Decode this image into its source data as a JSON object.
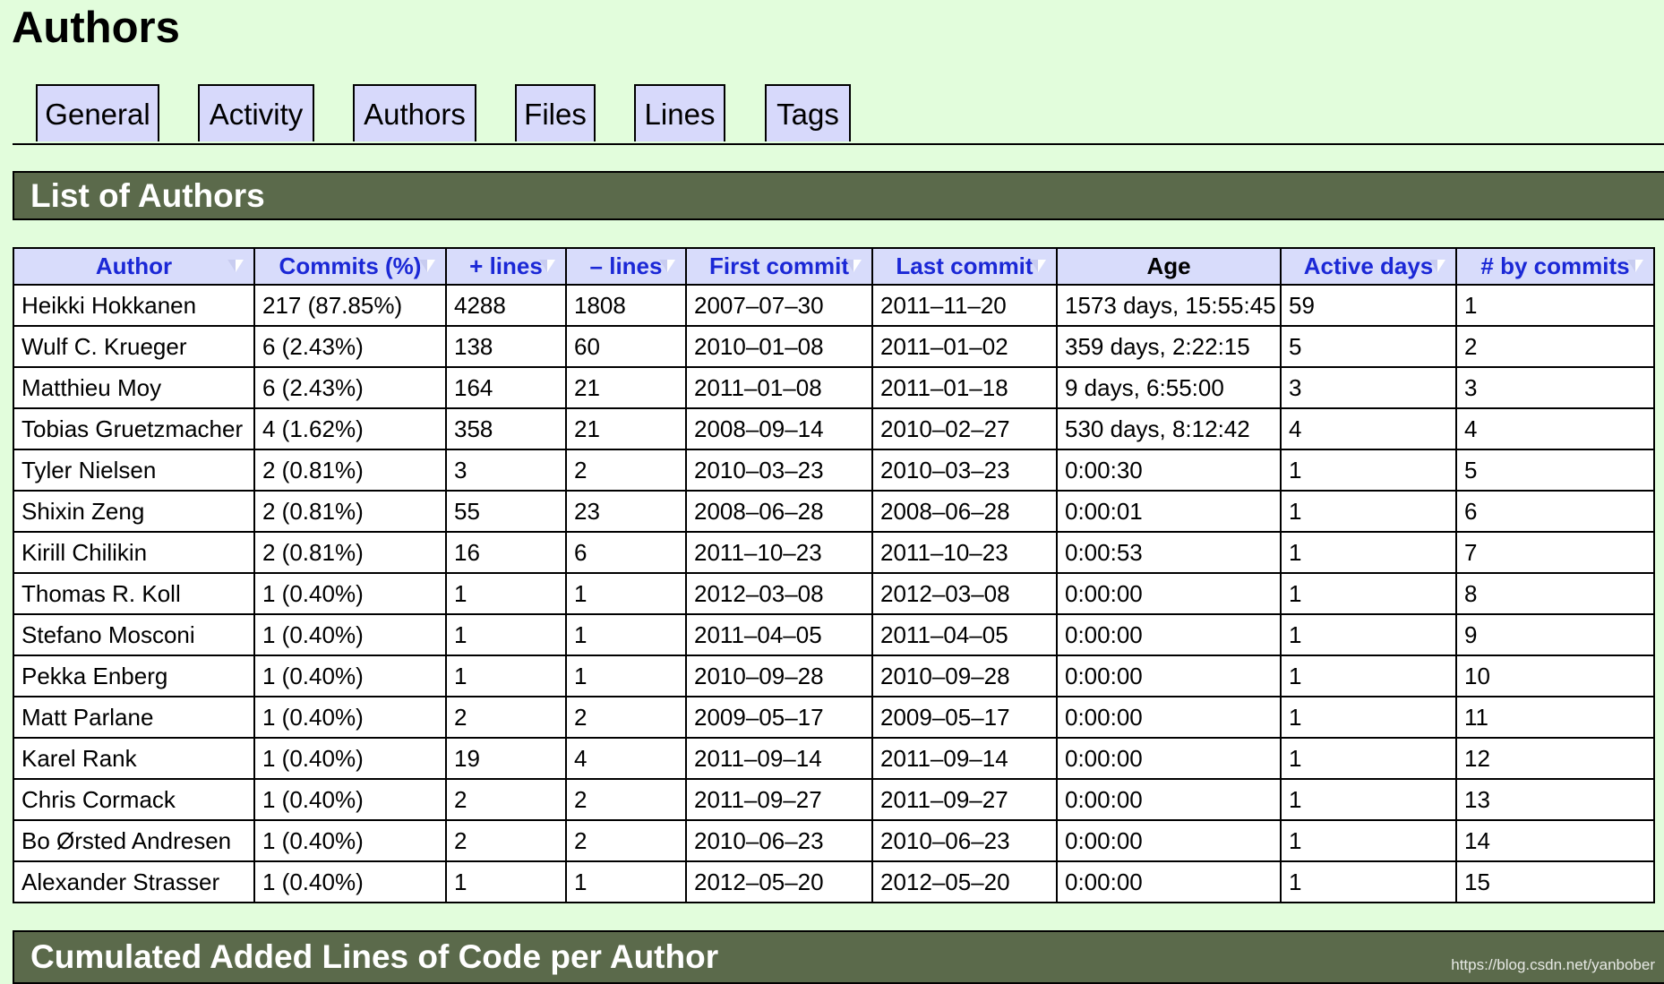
{
  "page": {
    "title": "Authors"
  },
  "tabs": [
    {
      "label": "General"
    },
    {
      "label": "Activity"
    },
    {
      "label": "Authors"
    },
    {
      "label": "Files"
    },
    {
      "label": "Lines"
    },
    {
      "label": "Tags"
    }
  ],
  "sections": {
    "list_title": "List of Authors",
    "cumulated_title": "Cumulated Added Lines of Code per Author"
  },
  "table": {
    "columns": [
      {
        "label": "Author",
        "sortable": true
      },
      {
        "label": "Commits (%)",
        "sortable": true
      },
      {
        "label": "+ lines",
        "sortable": true
      },
      {
        "label": "– lines",
        "sortable": true
      },
      {
        "label": "First commit",
        "sortable": true
      },
      {
        "label": "Last commit",
        "sortable": true
      },
      {
        "label": "Age",
        "sortable": false
      },
      {
        "label": "Active days",
        "sortable": true
      },
      {
        "label": "# by commits",
        "sortable": true
      }
    ],
    "rows": [
      [
        "Heikki Hokkanen",
        "217 (87.85%)",
        "4288",
        "1808",
        "2007–07–30",
        "2011–11–20",
        "1573 days, 15:55:45",
        "59",
        "1"
      ],
      [
        "Wulf C. Krueger",
        "6 (2.43%)",
        "138",
        "60",
        "2010–01–08",
        "2011–01–02",
        "359 days, 2:22:15",
        "5",
        "2"
      ],
      [
        "Matthieu Moy",
        "6 (2.43%)",
        "164",
        "21",
        "2011–01–08",
        "2011–01–18",
        "9 days, 6:55:00",
        "3",
        "3"
      ],
      [
        "Tobias Gruetzmacher",
        "4 (1.62%)",
        "358",
        "21",
        "2008–09–14",
        "2010–02–27",
        "530 days, 8:12:42",
        "4",
        "4"
      ],
      [
        "Tyler Nielsen",
        "2 (0.81%)",
        "3",
        "2",
        "2010–03–23",
        "2010–03–23",
        "0:00:30",
        "1",
        "5"
      ],
      [
        "Shixin Zeng",
        "2 (0.81%)",
        "55",
        "23",
        "2008–06–28",
        "2008–06–28",
        "0:00:01",
        "1",
        "6"
      ],
      [
        "Kirill Chilikin",
        "2 (0.81%)",
        "16",
        "6",
        "2011–10–23",
        "2011–10–23",
        "0:00:53",
        "1",
        "7"
      ],
      [
        "Thomas R. Koll",
        "1 (0.40%)",
        "1",
        "1",
        "2012–03–08",
        "2012–03–08",
        "0:00:00",
        "1",
        "8"
      ],
      [
        "Stefano Mosconi",
        "1 (0.40%)",
        "1",
        "1",
        "2011–04–05",
        "2011–04–05",
        "0:00:00",
        "1",
        "9"
      ],
      [
        "Pekka Enberg",
        "1 (0.40%)",
        "1",
        "1",
        "2010–09–28",
        "2010–09–28",
        "0:00:00",
        "1",
        "10"
      ],
      [
        "Matt Parlane",
        "1 (0.40%)",
        "2",
        "2",
        "2009–05–17",
        "2009–05–17",
        "0:00:00",
        "1",
        "11"
      ],
      [
        "Karel Rank",
        "1 (0.40%)",
        "19",
        "4",
        "2011–09–14",
        "2011–09–14",
        "0:00:00",
        "1",
        "12"
      ],
      [
        "Chris Cormack",
        "1 (0.40%)",
        "2",
        "2",
        "2011–09–27",
        "2011–09–27",
        "0:00:00",
        "1",
        "13"
      ],
      [
        "Bo Ørsted Andresen",
        "1 (0.40%)",
        "2",
        "2",
        "2010–06–23",
        "2010–06–23",
        "0:00:00",
        "1",
        "14"
      ],
      [
        "Alexander Strasser",
        "1 (0.40%)",
        "1",
        "1",
        "2012–05–20",
        "2012–05–20",
        "0:00:00",
        "1",
        "15"
      ]
    ]
  },
  "watermark": "https://blog.csdn.net/yanbober",
  "colors": {
    "background": "#e2fddc",
    "section_header": "#5b6a4b",
    "tab_background": "#d7d9fb",
    "header_link": "#1b28d6"
  },
  "icons": {
    "sort": "sort-triangle-icon"
  }
}
